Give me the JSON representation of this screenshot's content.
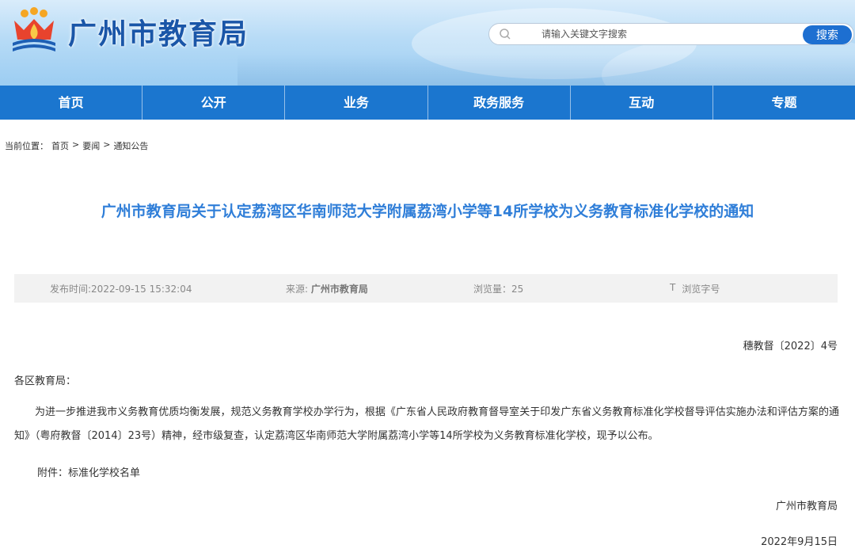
{
  "header": {
    "site_title": "广州市教育局",
    "logo_icon": "education-bureau-logo-icon",
    "search": {
      "placeholder": "请输入关键文字搜索",
      "button_label": "搜索",
      "icon": "search-icon"
    }
  },
  "nav": {
    "items": [
      {
        "label": "首页"
      },
      {
        "label": "公开"
      },
      {
        "label": "业务"
      },
      {
        "label": "政务服务"
      },
      {
        "label": "互动"
      },
      {
        "label": "专题"
      }
    ]
  },
  "breadcrumb": {
    "prefix": "当前位置：",
    "items": [
      "首页",
      "要闻",
      "通知公告"
    ],
    "separator": ">"
  },
  "article": {
    "title": "广州市教育局关于认定荔湾区华南师范大学附属荔湾小学等14所学校为义务教育标准化学校的通知",
    "meta": {
      "publish_time": "发布时间:2022-09-15 15:32:04",
      "source_label": "来源: ",
      "source_value": "广州市教育局",
      "views": "浏览量：25",
      "font_icon": "T",
      "font_label": "浏览字号"
    },
    "doc_number": "穗教督〔2022〕4号",
    "salutation": "各区教育局：",
    "paragraph": "为进一步推进我市义务教育优质均衡发展，规范义务教育学校办学行为，根据《广东省人民政府教育督导室关于印发广东省义务教育标准化学校督导评估实施办法和评估方案的通知》（粤府教督〔2014〕23号）精神，经市级复查，认定荔湾区华南师范大学附属荔湾小学等14所学校为义务教育标准化学校，现予以公布。",
    "attachment": "附件：标准化学校名单",
    "signer": "广州市教育局",
    "date": "2022年9月15日"
  },
  "colors": {
    "nav_bg": "#1b76cf",
    "title_blue": "#2f7ed8",
    "site_title": "#1a56a8",
    "search_button": "#1d6fd1"
  }
}
